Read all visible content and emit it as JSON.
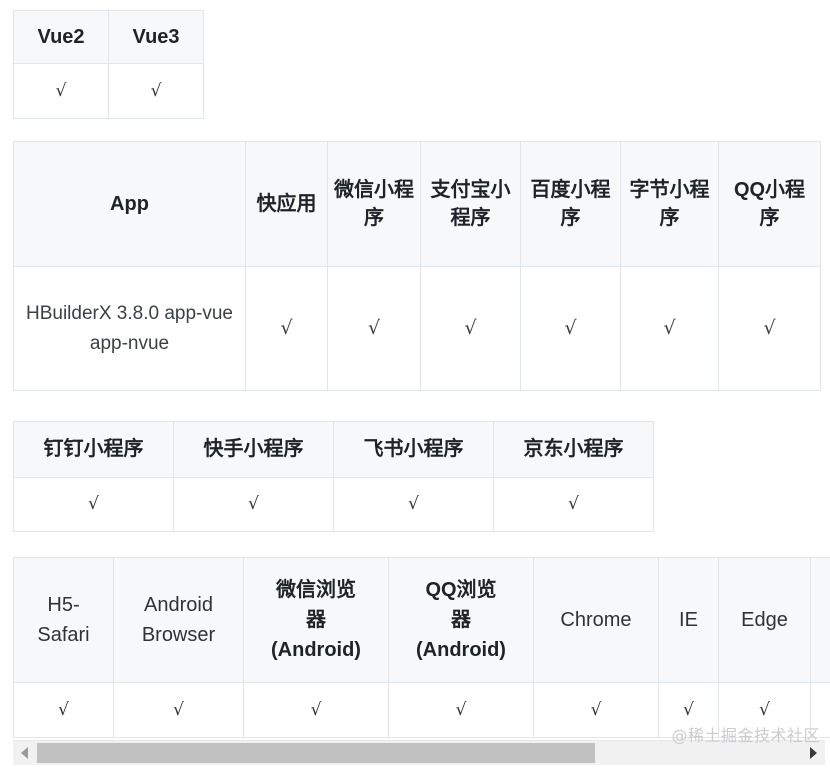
{
  "tables": {
    "vue": {
      "headers": [
        "Vue2",
        "Vue3"
      ],
      "rows": [
        [
          "√",
          "√"
        ]
      ]
    },
    "app": {
      "headers": [
        "App",
        "快应用",
        "微信小程序",
        "支付宝小程序",
        "百度小程序",
        "字节小程序",
        "QQ小程序"
      ],
      "rows": [
        [
          "HBuilderX 3.8.0 app-vue app-nvue",
          "√",
          "√",
          "√",
          "√",
          "√",
          "√"
        ]
      ]
    },
    "mini2": {
      "headers": [
        "钉钉小程序",
        "快手小程序",
        "飞书小程序",
        "京东小程序"
      ],
      "rows": [
        [
          "√",
          "√",
          "√",
          "√"
        ]
      ]
    },
    "browser": {
      "headers": [
        "H5-Safari",
        "Android Browser",
        "微信浏览器(Android)",
        "QQ浏览器(Android)",
        "Chrome",
        "IE",
        "Edge",
        ""
      ],
      "header_lines": {
        "h5": [
          "H5-",
          "Safari"
        ],
        "android": [
          "Android",
          "Browser"
        ],
        "wx": [
          "微信浏览",
          "器",
          "(Android)"
        ],
        "qq": [
          "QQ浏览",
          "器",
          "(Android)"
        ],
        "chrome": [
          "Chrome"
        ],
        "ie": [
          "IE"
        ],
        "edge": [
          "Edge"
        ]
      },
      "rows": [
        [
          "√",
          "√",
          "√",
          "√",
          "√",
          "√",
          "√",
          ""
        ]
      ]
    }
  },
  "scrollbar": {
    "left_arrow": "◀",
    "right_arrow": "▶",
    "thumb_position_percent": 0,
    "thumb_width_percent": 73
  },
  "watermark": {
    "text": "@稀土掘金技术社区"
  },
  "colors": {
    "header_bg": "#f7f8fa",
    "border": "#e3e6e8",
    "text": "#2f3337",
    "watermark": "#c9ccd0",
    "scroll_thumb": "#c1c1c1",
    "scroll_track": "#f1f1f1"
  }
}
